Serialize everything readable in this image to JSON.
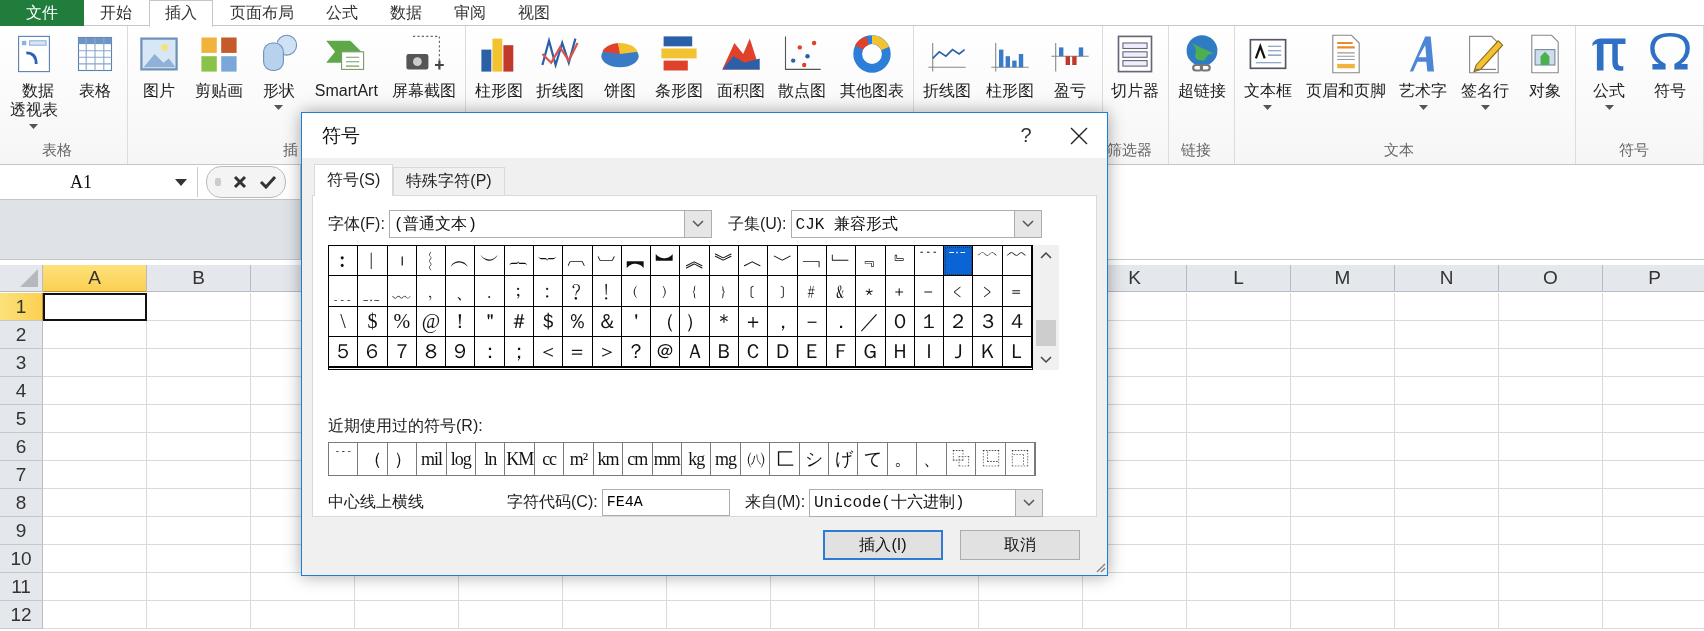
{
  "menu_tabs": [
    {
      "label": "文件",
      "kind": "file",
      "selected": false
    },
    {
      "label": "开始",
      "kind": "tab",
      "selected": false
    },
    {
      "label": "插入",
      "kind": "tab",
      "selected": true
    },
    {
      "label": "页面布局",
      "kind": "tab",
      "selected": false
    },
    {
      "label": "公式",
      "kind": "tab",
      "selected": false
    },
    {
      "label": "数据",
      "kind": "tab",
      "selected": false
    },
    {
      "label": "审阅",
      "kind": "tab",
      "selected": false
    },
    {
      "label": "视图",
      "kind": "tab",
      "selected": false
    }
  ],
  "ribbon": {
    "groups": [
      {
        "label": "表格",
        "items": [
          {
            "label": "数据透视表",
            "dropdown": true
          },
          {
            "label": "表格",
            "dropdown": false
          }
        ]
      },
      {
        "label": "插",
        "items": [
          {
            "label": "图片",
            "dropdown": false
          },
          {
            "label": "剪贴画",
            "dropdown": false
          },
          {
            "label": "形状",
            "dropdown": true
          },
          {
            "label": "SmartArt",
            "dropdown": false
          },
          {
            "label": "屏幕截图",
            "dropdown": false
          }
        ]
      },
      {
        "items": [
          {
            "label": "柱形图",
            "dropdown": false
          },
          {
            "label": "折线图",
            "dropdown": false
          },
          {
            "label": "饼图",
            "dropdown": false
          },
          {
            "label": "条形图",
            "dropdown": false
          },
          {
            "label": "面积图",
            "dropdown": false
          },
          {
            "label": "散点图",
            "dropdown": false
          },
          {
            "label": "其他图表",
            "dropdown": false
          }
        ]
      },
      {
        "items": [
          {
            "label": "折线图",
            "dropdown": false
          },
          {
            "label": "柱形图",
            "dropdown": false
          },
          {
            "label": "盈亏",
            "dropdown": false
          }
        ]
      },
      {
        "label": "筛选器",
        "items": [
          {
            "label": "切片器",
            "dropdown": false
          }
        ]
      },
      {
        "label": "链接",
        "items": [
          {
            "label": "超链接",
            "dropdown": false
          }
        ]
      },
      {
        "label": "文本",
        "items": [
          {
            "label": "文本框",
            "dropdown": true
          },
          {
            "label": "页眉和页脚",
            "dropdown": false
          },
          {
            "label": "艺术字",
            "dropdown": true
          },
          {
            "label": "签名行",
            "dropdown": true
          },
          {
            "label": "对象",
            "dropdown": false
          }
        ]
      },
      {
        "label": "符号",
        "items": [
          {
            "label": "公式",
            "dropdown": true
          },
          {
            "label": "符号",
            "dropdown": false
          }
        ]
      }
    ]
  },
  "formula_bar": {
    "name_box": "A1"
  },
  "sheet": {
    "columns_left": [
      {
        "label": "A",
        "selected": true
      },
      {
        "label": "B",
        "selected": false
      }
    ],
    "columns_right": [
      {
        "label": "K",
        "selected": false
      },
      {
        "label": "L",
        "selected": false
      },
      {
        "label": "M",
        "selected": false
      },
      {
        "label": "N",
        "selected": false
      },
      {
        "label": "O",
        "selected": false
      },
      {
        "label": "P",
        "selected": false
      }
    ],
    "rows": [
      {
        "label": "1",
        "selected": true
      },
      {
        "label": "2",
        "selected": false
      },
      {
        "label": "3",
        "selected": false
      },
      {
        "label": "4",
        "selected": false
      },
      {
        "label": "5",
        "selected": false
      },
      {
        "label": "6",
        "selected": false
      },
      {
        "label": "7",
        "selected": false
      },
      {
        "label": "8",
        "selected": false
      },
      {
        "label": "9",
        "selected": false
      },
      {
        "label": "10",
        "selected": false
      },
      {
        "label": "11",
        "selected": false
      },
      {
        "label": "12",
        "selected": false
      }
    ]
  },
  "dialog": {
    "title": "符号",
    "help": "?",
    "tabs": [
      {
        "label": "符号(S)",
        "selected": true
      },
      {
        "label": "特殊字符(P)",
        "selected": false
      }
    ],
    "font_label": "字体(F):",
    "font": "(普通文本)",
    "subset_label": "子集(U):",
    "subset": "CJK 兼容形式",
    "symbols": [
      [
        {
          "c": "︰",
          "selected": false
        },
        {
          "c": "︱",
          "selected": false
        },
        {
          "c": "︲",
          "selected": false
        },
        {
          "c": "︴",
          "selected": false
        },
        {
          "c": "︵",
          "selected": false
        },
        {
          "c": "︶",
          "selected": false
        },
        {
          "c": "︷",
          "selected": false
        },
        {
          "c": "︸",
          "selected": false
        },
        {
          "c": "︹",
          "selected": false
        },
        {
          "c": "︺",
          "selected": false
        },
        {
          "c": "︻",
          "selected": false
        },
        {
          "c": "︼",
          "selected": false
        },
        {
          "c": "︽",
          "selected": false
        },
        {
          "c": "︾",
          "selected": false
        },
        {
          "c": "︿",
          "selected": false
        },
        {
          "c": "﹀",
          "selected": false
        },
        {
          "c": "﹁",
          "selected": false
        },
        {
          "c": "﹂",
          "selected": false
        },
        {
          "c": "﹃",
          "selected": false
        },
        {
          "c": "﹄",
          "selected": false
        },
        {
          "c": "﹉",
          "selected": false
        },
        {
          "c": "﹊",
          "selected": true
        },
        {
          "c": "﹋",
          "selected": false
        },
        {
          "c": "﹌",
          "selected": false
        }
      ],
      [
        {
          "c": "﹍",
          "selected": false
        },
        {
          "c": "﹎",
          "selected": false
        },
        {
          "c": "﹏",
          "selected": false
        },
        {
          "c": "﹐",
          "selected": false
        },
        {
          "c": "﹑",
          "selected": false
        },
        {
          "c": "﹒",
          "selected": false
        },
        {
          "c": "﹔",
          "selected": false
        },
        {
          "c": "﹕",
          "selected": false
        },
        {
          "c": "﹖",
          "selected": false
        },
        {
          "c": "﹗",
          "selected": false
        },
        {
          "c": "﹙",
          "selected": false
        },
        {
          "c": "﹚",
          "selected": false
        },
        {
          "c": "﹛",
          "selected": false
        },
        {
          "c": "﹜",
          "selected": false
        },
        {
          "c": "﹝",
          "selected": false
        },
        {
          "c": "﹞",
          "selected": false
        },
        {
          "c": "﹟",
          "selected": false
        },
        {
          "c": "﹠",
          "selected": false
        },
        {
          "c": "﹡",
          "selected": false
        },
        {
          "c": "﹢",
          "selected": false
        },
        {
          "c": "﹣",
          "selected": false
        },
        {
          "c": "﹤",
          "selected": false
        },
        {
          "c": "﹥",
          "selected": false
        },
        {
          "c": "﹦",
          "selected": false
        }
      ],
      [
        {
          "c": "\\",
          "selected": false
        },
        {
          "c": "$",
          "selected": false
        },
        {
          "c": "%",
          "selected": false
        },
        {
          "c": "@",
          "selected": false
        },
        {
          "c": "！",
          "selected": false
        },
        {
          "c": "＂",
          "selected": false
        },
        {
          "c": "＃",
          "selected": false
        },
        {
          "c": "＄",
          "selected": false
        },
        {
          "c": "％",
          "selected": false
        },
        {
          "c": "＆",
          "selected": false
        },
        {
          "c": "＇",
          "selected": false
        },
        {
          "c": "（",
          "selected": false
        },
        {
          "c": "）",
          "selected": false
        },
        {
          "c": "＊",
          "selected": false
        },
        {
          "c": "＋",
          "selected": false
        },
        {
          "c": "，",
          "selected": false
        },
        {
          "c": "－",
          "selected": false
        },
        {
          "c": "．",
          "selected": false
        },
        {
          "c": "／",
          "selected": false
        },
        {
          "c": "０",
          "selected": false
        },
        {
          "c": "１",
          "selected": false
        },
        {
          "c": "２",
          "selected": false
        },
        {
          "c": "３",
          "selected": false
        },
        {
          "c": "４",
          "selected": false
        }
      ],
      [
        {
          "c": "５",
          "selected": false
        },
        {
          "c": "６",
          "selected": false
        },
        {
          "c": "７",
          "selected": false
        },
        {
          "c": "８",
          "selected": false
        },
        {
          "c": "９",
          "selected": false
        },
        {
          "c": "：",
          "selected": false
        },
        {
          "c": "；",
          "selected": false
        },
        {
          "c": "＜",
          "selected": false
        },
        {
          "c": "＝",
          "selected": false
        },
        {
          "c": "＞",
          "selected": false
        },
        {
          "c": "？",
          "selected": false
        },
        {
          "c": "＠",
          "selected": false
        },
        {
          "c": "Ａ",
          "selected": false
        },
        {
          "c": "Ｂ",
          "selected": false
        },
        {
          "c": "Ｃ",
          "selected": false
        },
        {
          "c": "Ｄ",
          "selected": false
        },
        {
          "c": "Ｅ",
          "selected": false
        },
        {
          "c": "Ｆ",
          "selected": false
        },
        {
          "c": "Ｇ",
          "selected": false
        },
        {
          "c": "Ｈ",
          "selected": false
        },
        {
          "c": "Ｉ",
          "selected": false
        },
        {
          "c": "Ｊ",
          "selected": false
        },
        {
          "c": "Ｋ",
          "selected": false
        },
        {
          "c": "Ｌ",
          "selected": false
        }
      ]
    ],
    "recent_label": "近期使用过的符号(R):",
    "recent": [
      "﹉",
      "（",
      "）",
      "mil",
      "log",
      "ln",
      "KM",
      "cc",
      "m²",
      "km",
      "cm",
      "mm",
      "kg",
      "mg",
      "㈧",
      "⼕",
      "シ",
      "げ",
      "て",
      "。",
      "、",
      "⿻",
      "⿺",
      "⿹"
    ],
    "description": "中心线上横线",
    "code_label": "字符代码(C):",
    "code": "FE4A",
    "from_label": "来自(M):",
    "from": "Unicode(十六进制)",
    "buttons": [
      {
        "label": "插入(I)",
        "default": true
      },
      {
        "label": "取消",
        "default": false
      }
    ]
  }
}
